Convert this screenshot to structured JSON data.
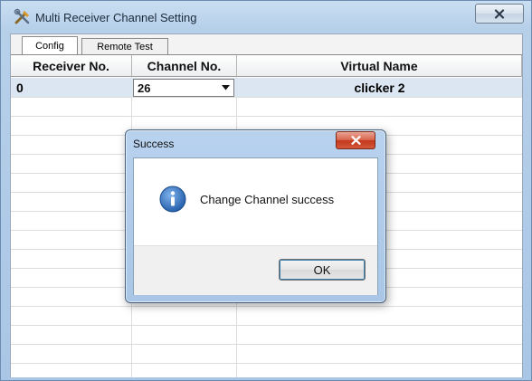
{
  "window": {
    "title": "Multi Receiver Channel Setting",
    "close_icon": "close-icon"
  },
  "tabs": [
    {
      "label": "Config",
      "selected": true
    },
    {
      "label": "Remote Test",
      "selected": false
    }
  ],
  "table": {
    "columns": [
      "Receiver No.",
      "Channel No.",
      "Virtual Name"
    ],
    "rows": [
      {
        "receiver": "0",
        "channel": "26",
        "virtual_name": "clicker 2"
      }
    ]
  },
  "dialog": {
    "title": "Success",
    "message": "Change Channel success",
    "ok_label": "OK",
    "icon": "info-icon"
  },
  "colors": {
    "selected_row": "#dce6f2",
    "dialog_close": "#c3381d",
    "info_icon": "#2f6fbe"
  }
}
